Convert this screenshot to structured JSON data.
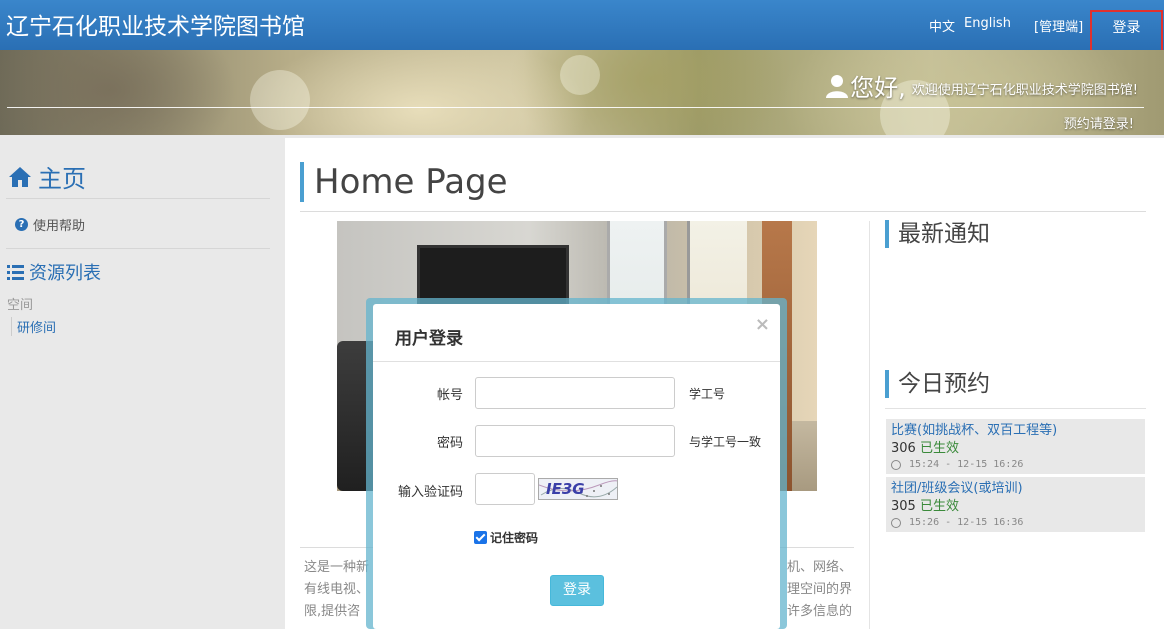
{
  "header": {
    "brand": "辽宁石化职业技术学院图书馆",
    "lang_zh": "中文",
    "lang_en": "English",
    "admin": "[管理端]",
    "login": "登录"
  },
  "banner": {
    "greeting": "您好,",
    "welcome": "欢迎使用辽宁石化职业技术学院图书馆!",
    "reserve_note": "预约请登录!"
  },
  "sidebar": {
    "home": "主页",
    "help": "使用帮助",
    "resource_list": "资源列表",
    "space_label": "空间",
    "room": "研修间"
  },
  "main": {
    "page_title": "Home Page",
    "intro_lines": [
      {
        "left": "这是一种新",
        "right": "机、网络、"
      },
      {
        "left": "有线电视、",
        "right": "理空间的界"
      },
      {
        "left": "限,提供咨",
        "right": "许多信息的"
      }
    ],
    "notice_title": "最新通知",
    "today_title": "今日预约",
    "reservations": [
      {
        "name": "比赛(如挑战杯、双百工程等)",
        "room": "306",
        "status": "已生效",
        "time": "15:24 - 12-15 16:26"
      },
      {
        "name": "社团/班级会议(或培训)",
        "room": "305",
        "status": "已生效",
        "time": "15:26 - 12-15 16:36"
      }
    ]
  },
  "modal": {
    "title": "用户登录",
    "close": "×",
    "account_label": "帐号",
    "account_value": "",
    "account_hint": "学工号",
    "password_label": "密码",
    "password_value": "",
    "password_hint": "与学工号一致",
    "captcha_label": "输入验证码",
    "captcha_value": "",
    "captcha_image_text": "IE3G",
    "remember_label": "记住密码",
    "remember_checked": true,
    "submit": "登录"
  },
  "colors": {
    "navbar": "#2a6fb4",
    "accent": "#4a9fd1",
    "button": "#5bc0de",
    "highlight_border": "#e0312d"
  }
}
